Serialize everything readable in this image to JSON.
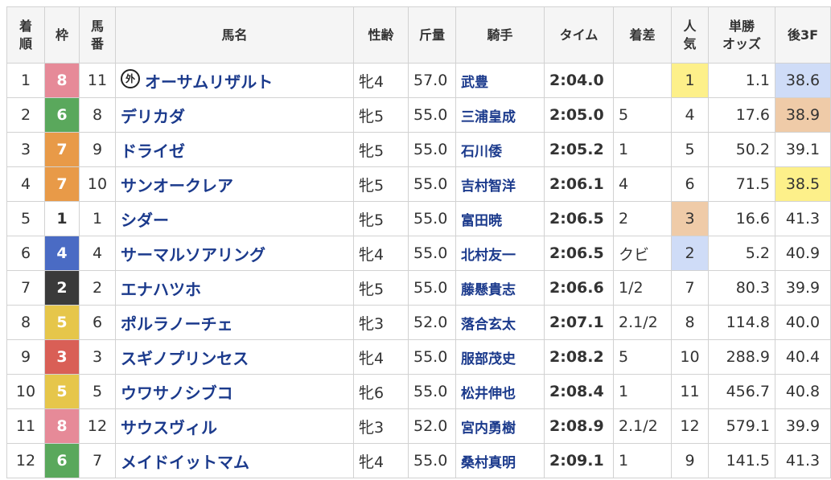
{
  "headers": {
    "rank_line1": "着",
    "rank_line2": "順",
    "waku": "枠",
    "umaban_line1": "馬",
    "umaban_line2": "番",
    "name": "馬名",
    "sexage": "性齢",
    "kinryo": "斤量",
    "jockey": "騎手",
    "time": "タイム",
    "margin": "着差",
    "pop_line1": "人",
    "pop_line2": "気",
    "odds_line1": "単勝",
    "odds_line2": "オッズ",
    "last3f": "後3F"
  },
  "colors": {
    "waku": {
      "1": {
        "bg": "#ffffff",
        "fg": "#333333"
      },
      "2": {
        "bg": "#3a3a3a",
        "fg": "#ffffff"
      },
      "3": {
        "bg": "#d95f56",
        "fg": "#ffffff"
      },
      "4": {
        "bg": "#4a6bc4",
        "fg": "#ffffff"
      },
      "5": {
        "bg": "#e6c64a",
        "fg": "#ffffff"
      },
      "6": {
        "bg": "#5aa85c",
        "fg": "#ffffff"
      },
      "7": {
        "bg": "#e89a48",
        "fg": "#ffffff"
      },
      "8": {
        "bg": "#e68a98",
        "fg": "#ffffff"
      }
    },
    "highlight_gold": "#fdf08a",
    "highlight_silver": "#cfdcf7",
    "highlight_bronze": "#efcba8"
  },
  "rows": [
    {
      "rank": "1",
      "waku": "8",
      "umaban": "11",
      "foreign_mark": "外",
      "name": "オーサムリザルト",
      "sexage": "牝4",
      "kinryo": "57.0",
      "jockey": "武豊",
      "time": "2:04.0",
      "margin": "",
      "pop": "1",
      "pop_hl": "gold",
      "odds": "1.1",
      "odds_red": true,
      "last3f": "38.6",
      "last3f_hl": "silver"
    },
    {
      "rank": "2",
      "waku": "6",
      "umaban": "8",
      "foreign_mark": "",
      "name": "デリカダ",
      "sexage": "牝5",
      "kinryo": "55.0",
      "jockey": "三浦皇成",
      "time": "2:05.0",
      "margin": "5",
      "pop": "4",
      "pop_hl": "",
      "odds": "17.6",
      "odds_red": false,
      "last3f": "38.9",
      "last3f_hl": "bronze"
    },
    {
      "rank": "3",
      "waku": "7",
      "umaban": "9",
      "foreign_mark": "",
      "name": "ドライゼ",
      "sexage": "牝5",
      "kinryo": "55.0",
      "jockey": "石川倭",
      "time": "2:05.2",
      "margin": "1",
      "pop": "5",
      "pop_hl": "",
      "odds": "50.2",
      "odds_red": false,
      "last3f": "39.1",
      "last3f_hl": ""
    },
    {
      "rank": "4",
      "waku": "7",
      "umaban": "10",
      "foreign_mark": "",
      "name": "サンオークレア",
      "sexage": "牝5",
      "kinryo": "55.0",
      "jockey": "吉村智洋",
      "time": "2:06.1",
      "margin": "4",
      "pop": "6",
      "pop_hl": "",
      "odds": "71.5",
      "odds_red": false,
      "last3f": "38.5",
      "last3f_hl": "gold"
    },
    {
      "rank": "5",
      "waku": "1",
      "umaban": "1",
      "foreign_mark": "",
      "name": "シダー",
      "sexage": "牝5",
      "kinryo": "55.0",
      "jockey": "富田暁",
      "time": "2:06.5",
      "margin": "2",
      "pop": "3",
      "pop_hl": "bronze",
      "odds": "16.6",
      "odds_red": false,
      "last3f": "41.3",
      "last3f_hl": ""
    },
    {
      "rank": "6",
      "waku": "4",
      "umaban": "4",
      "foreign_mark": "",
      "name": "サーマルソアリング",
      "sexage": "牝4",
      "kinryo": "55.0",
      "jockey": "北村友一",
      "time": "2:06.5",
      "margin": "クビ",
      "pop": "2",
      "pop_hl": "silver",
      "odds": "5.2",
      "odds_red": true,
      "last3f": "40.9",
      "last3f_hl": ""
    },
    {
      "rank": "7",
      "waku": "2",
      "umaban": "2",
      "foreign_mark": "",
      "name": "エナハツホ",
      "sexage": "牝5",
      "kinryo": "55.0",
      "jockey": "藤懸貴志",
      "time": "2:06.6",
      "margin": "1/2",
      "pop": "7",
      "pop_hl": "",
      "odds": "80.3",
      "odds_red": false,
      "last3f": "39.9",
      "last3f_hl": ""
    },
    {
      "rank": "8",
      "waku": "5",
      "umaban": "6",
      "foreign_mark": "",
      "name": "ポルラノーチェ",
      "sexage": "牝3",
      "kinryo": "52.0",
      "jockey": "落合玄太",
      "time": "2:07.1",
      "margin": "2.1/2",
      "pop": "8",
      "pop_hl": "",
      "odds": "114.8",
      "odds_red": false,
      "last3f": "40.0",
      "last3f_hl": ""
    },
    {
      "rank": "9",
      "waku": "3",
      "umaban": "3",
      "foreign_mark": "",
      "name": "スギノプリンセス",
      "sexage": "牝4",
      "kinryo": "55.0",
      "jockey": "服部茂史",
      "time": "2:08.2",
      "margin": "5",
      "pop": "10",
      "pop_hl": "",
      "odds": "288.9",
      "odds_red": false,
      "last3f": "40.4",
      "last3f_hl": ""
    },
    {
      "rank": "10",
      "waku": "5",
      "umaban": "5",
      "foreign_mark": "",
      "name": "ウワサノシブコ",
      "sexage": "牝6",
      "kinryo": "55.0",
      "jockey": "松井伸也",
      "time": "2:08.4",
      "margin": "1",
      "pop": "11",
      "pop_hl": "",
      "odds": "456.7",
      "odds_red": false,
      "last3f": "40.8",
      "last3f_hl": ""
    },
    {
      "rank": "11",
      "waku": "8",
      "umaban": "12",
      "foreign_mark": "",
      "name": "サウスヴィル",
      "sexage": "牝3",
      "kinryo": "52.0",
      "jockey": "宮内勇樹",
      "time": "2:08.9",
      "margin": "2.1/2",
      "pop": "12",
      "pop_hl": "",
      "odds": "579.1",
      "odds_red": false,
      "last3f": "39.9",
      "last3f_hl": ""
    },
    {
      "rank": "12",
      "waku": "6",
      "umaban": "7",
      "foreign_mark": "",
      "name": "メイドイットマム",
      "sexage": "牝4",
      "kinryo": "55.0",
      "jockey": "桑村真明",
      "time": "2:09.1",
      "margin": "1",
      "pop": "9",
      "pop_hl": "",
      "odds": "141.5",
      "odds_red": false,
      "last3f": "41.3",
      "last3f_hl": ""
    }
  ]
}
